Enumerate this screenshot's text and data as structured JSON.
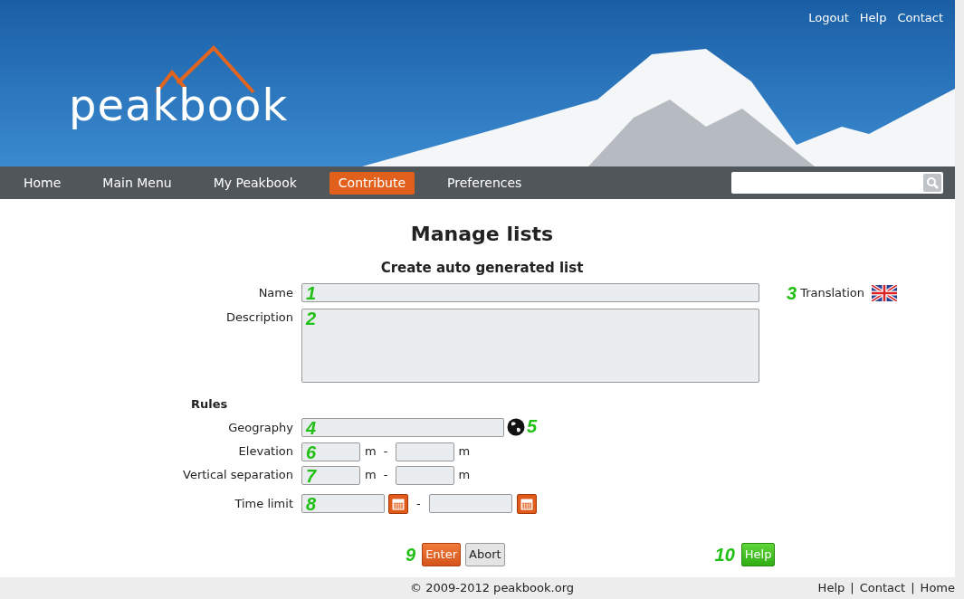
{
  "top_links": [
    "Logout",
    "Help",
    "Contact"
  ],
  "logo": {
    "text": "peakbook"
  },
  "nav": [
    {
      "label": "Home",
      "selected": false
    },
    {
      "label": "Main Menu",
      "selected": false
    },
    {
      "label": "My Peakbook",
      "selected": false
    },
    {
      "label": "Contribute",
      "selected": true
    },
    {
      "label": "Preferences",
      "selected": false
    }
  ],
  "page_title": "Manage lists",
  "form_title": "Create auto generated list",
  "name": {
    "label": "Name",
    "callout": "1"
  },
  "translation": {
    "callout": "3",
    "label": "Translation"
  },
  "description": {
    "label": "Description",
    "callout": "2"
  },
  "rules_heading": "Rules",
  "geography": {
    "label": "Geography",
    "callout": "4",
    "map_callout": "5"
  },
  "ranges": [
    {
      "kind": "meters",
      "label": "Elevation",
      "callout": "6",
      "from_unit": "m",
      "separator": "-",
      "to_unit": "m"
    },
    {
      "kind": "meters",
      "label": "Vertical separation",
      "callout": "7",
      "from_unit": "m",
      "separator": "-",
      "to_unit": "m"
    },
    {
      "kind": "date",
      "label": "Time limit",
      "callout": "8",
      "separator": "-"
    }
  ],
  "buttons": [
    {
      "kind": "primary",
      "label": "Enter",
      "callout": "9"
    },
    {
      "kind": "secondary",
      "label": "Abort"
    },
    {
      "kind": "help",
      "label": "Help",
      "callout": "10"
    }
  ],
  "footer": {
    "copyright": "© 2009-2012 peakbook.org",
    "links": [
      "Help",
      "Contact",
      "Home"
    ],
    "separator": "|"
  }
}
